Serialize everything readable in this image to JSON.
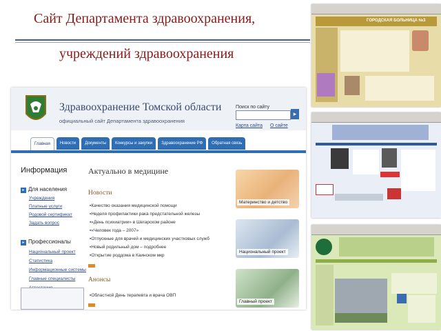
{
  "slide": {
    "title_line1": "Сайт Департамента здравоохранения,",
    "title_line2": "учреждений здравоохранения"
  },
  "site": {
    "title": "Здравоохранение Томской области",
    "subtitle": "официальный сайт Департамента здравоохранения",
    "search_label": "Поиск по сайту",
    "search_value": "",
    "links": [
      "Карта сайта",
      "О сайте"
    ],
    "tabs": [
      "Главная",
      "Новости",
      "Документы",
      "Конкурсы и закупки",
      "Здравоохранение РФ",
      "Обратная связь"
    ],
    "info_heading": "Информация",
    "sections": [
      {
        "label": "Для населения",
        "items": [
          "Учреждения",
          "Платные услуги",
          "Родовой сертификат",
          "Задать вопрос"
        ]
      },
      {
        "label": "Профессионалы",
        "items": [
          "Национальный проект",
          "Статистика",
          "Информационные системы",
          "Главные специалисты",
          "Аттестация"
        ]
      }
    ],
    "actual_heading": "Актуально в медицине",
    "news_heading": "Новости",
    "news": [
      "Качество оказания медицинской помощи",
      "Неделя профилактики рака предстательной железы",
      "«День психиатрии» в Шегарском районе",
      "«Человек года – 2007»",
      "Отпускные для врачей и медицинских участковых служб",
      "Новый родильный дом – подробнее",
      "Открытие роддома в Каинском мкр"
    ],
    "announce_heading": "Анонсы",
    "announces": [
      "Областной День терапевта и врача ОВП"
    ],
    "promos": [
      "Материнство и детство",
      "Национальный проект",
      "Главный проект"
    ]
  },
  "thumbnails": {
    "hospital3_banner": "ГОРОДСКАЯ БОЛЬНИЦА №3"
  },
  "colors": {
    "title_text": "#8b1a1a",
    "tab_blue": "#2f6eb5",
    "rule": "#4a5a86"
  }
}
